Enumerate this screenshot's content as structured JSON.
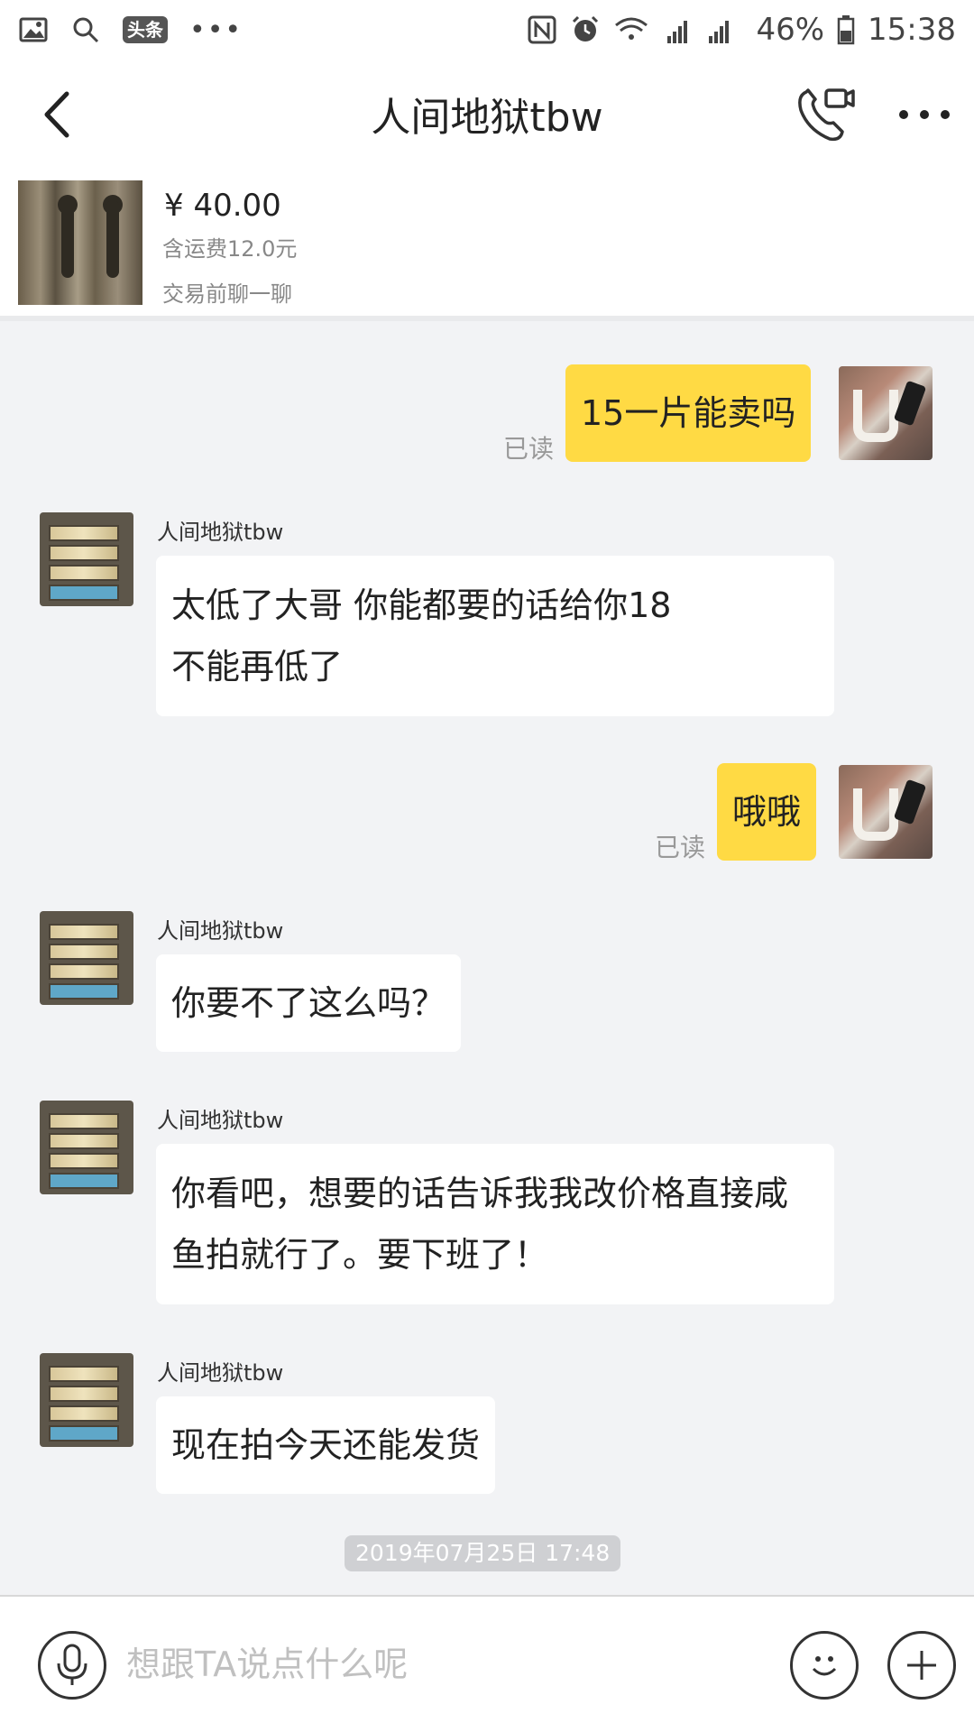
{
  "status_bar": {
    "left_icons": [
      "image-icon",
      "search-icon",
      "toutiao-icon",
      "more-dots-icon"
    ],
    "toutiao_label": "头条",
    "right_icons": [
      "nfc-icon",
      "alarm-icon",
      "wifi-icon",
      "signal-icon"
    ],
    "battery": "46%",
    "time": "15:38"
  },
  "nav": {
    "title": "人间地狱tbw"
  },
  "product": {
    "price": "¥ 40.00",
    "shipping": "含运费12.0元",
    "hint": "交易前聊一聊"
  },
  "messages": [
    {
      "from": "me",
      "text": "15一片能卖吗",
      "status": "已读"
    },
    {
      "from": "them",
      "sender": "人间地狱tbw",
      "lines": [
        "太低了大哥 你能都要的话给你18",
        "不能再低了"
      ]
    },
    {
      "from": "me",
      "text": "哦哦",
      "status": "已读"
    },
    {
      "from": "them",
      "sender": "人间地狱tbw",
      "lines": [
        "你要不了这么吗？"
      ]
    },
    {
      "from": "them",
      "sender": "人间地狱tbw",
      "lines": [
        "你看吧，想要的话告诉我我改价格直接咸",
        "鱼拍就行了。要下班了！"
      ]
    },
    {
      "from": "them",
      "sender": "人间地狱tbw",
      "lines": [
        "现在拍今天还能发货"
      ]
    }
  ],
  "timestamp": "2019年07月25日 17:48",
  "input": {
    "placeholder": "想跟TA说点什么呢",
    "value": ""
  },
  "colors": {
    "my_bubble": "#ffda44",
    "their_bubble": "#ffffff",
    "chat_background": "#f2f3f5"
  }
}
